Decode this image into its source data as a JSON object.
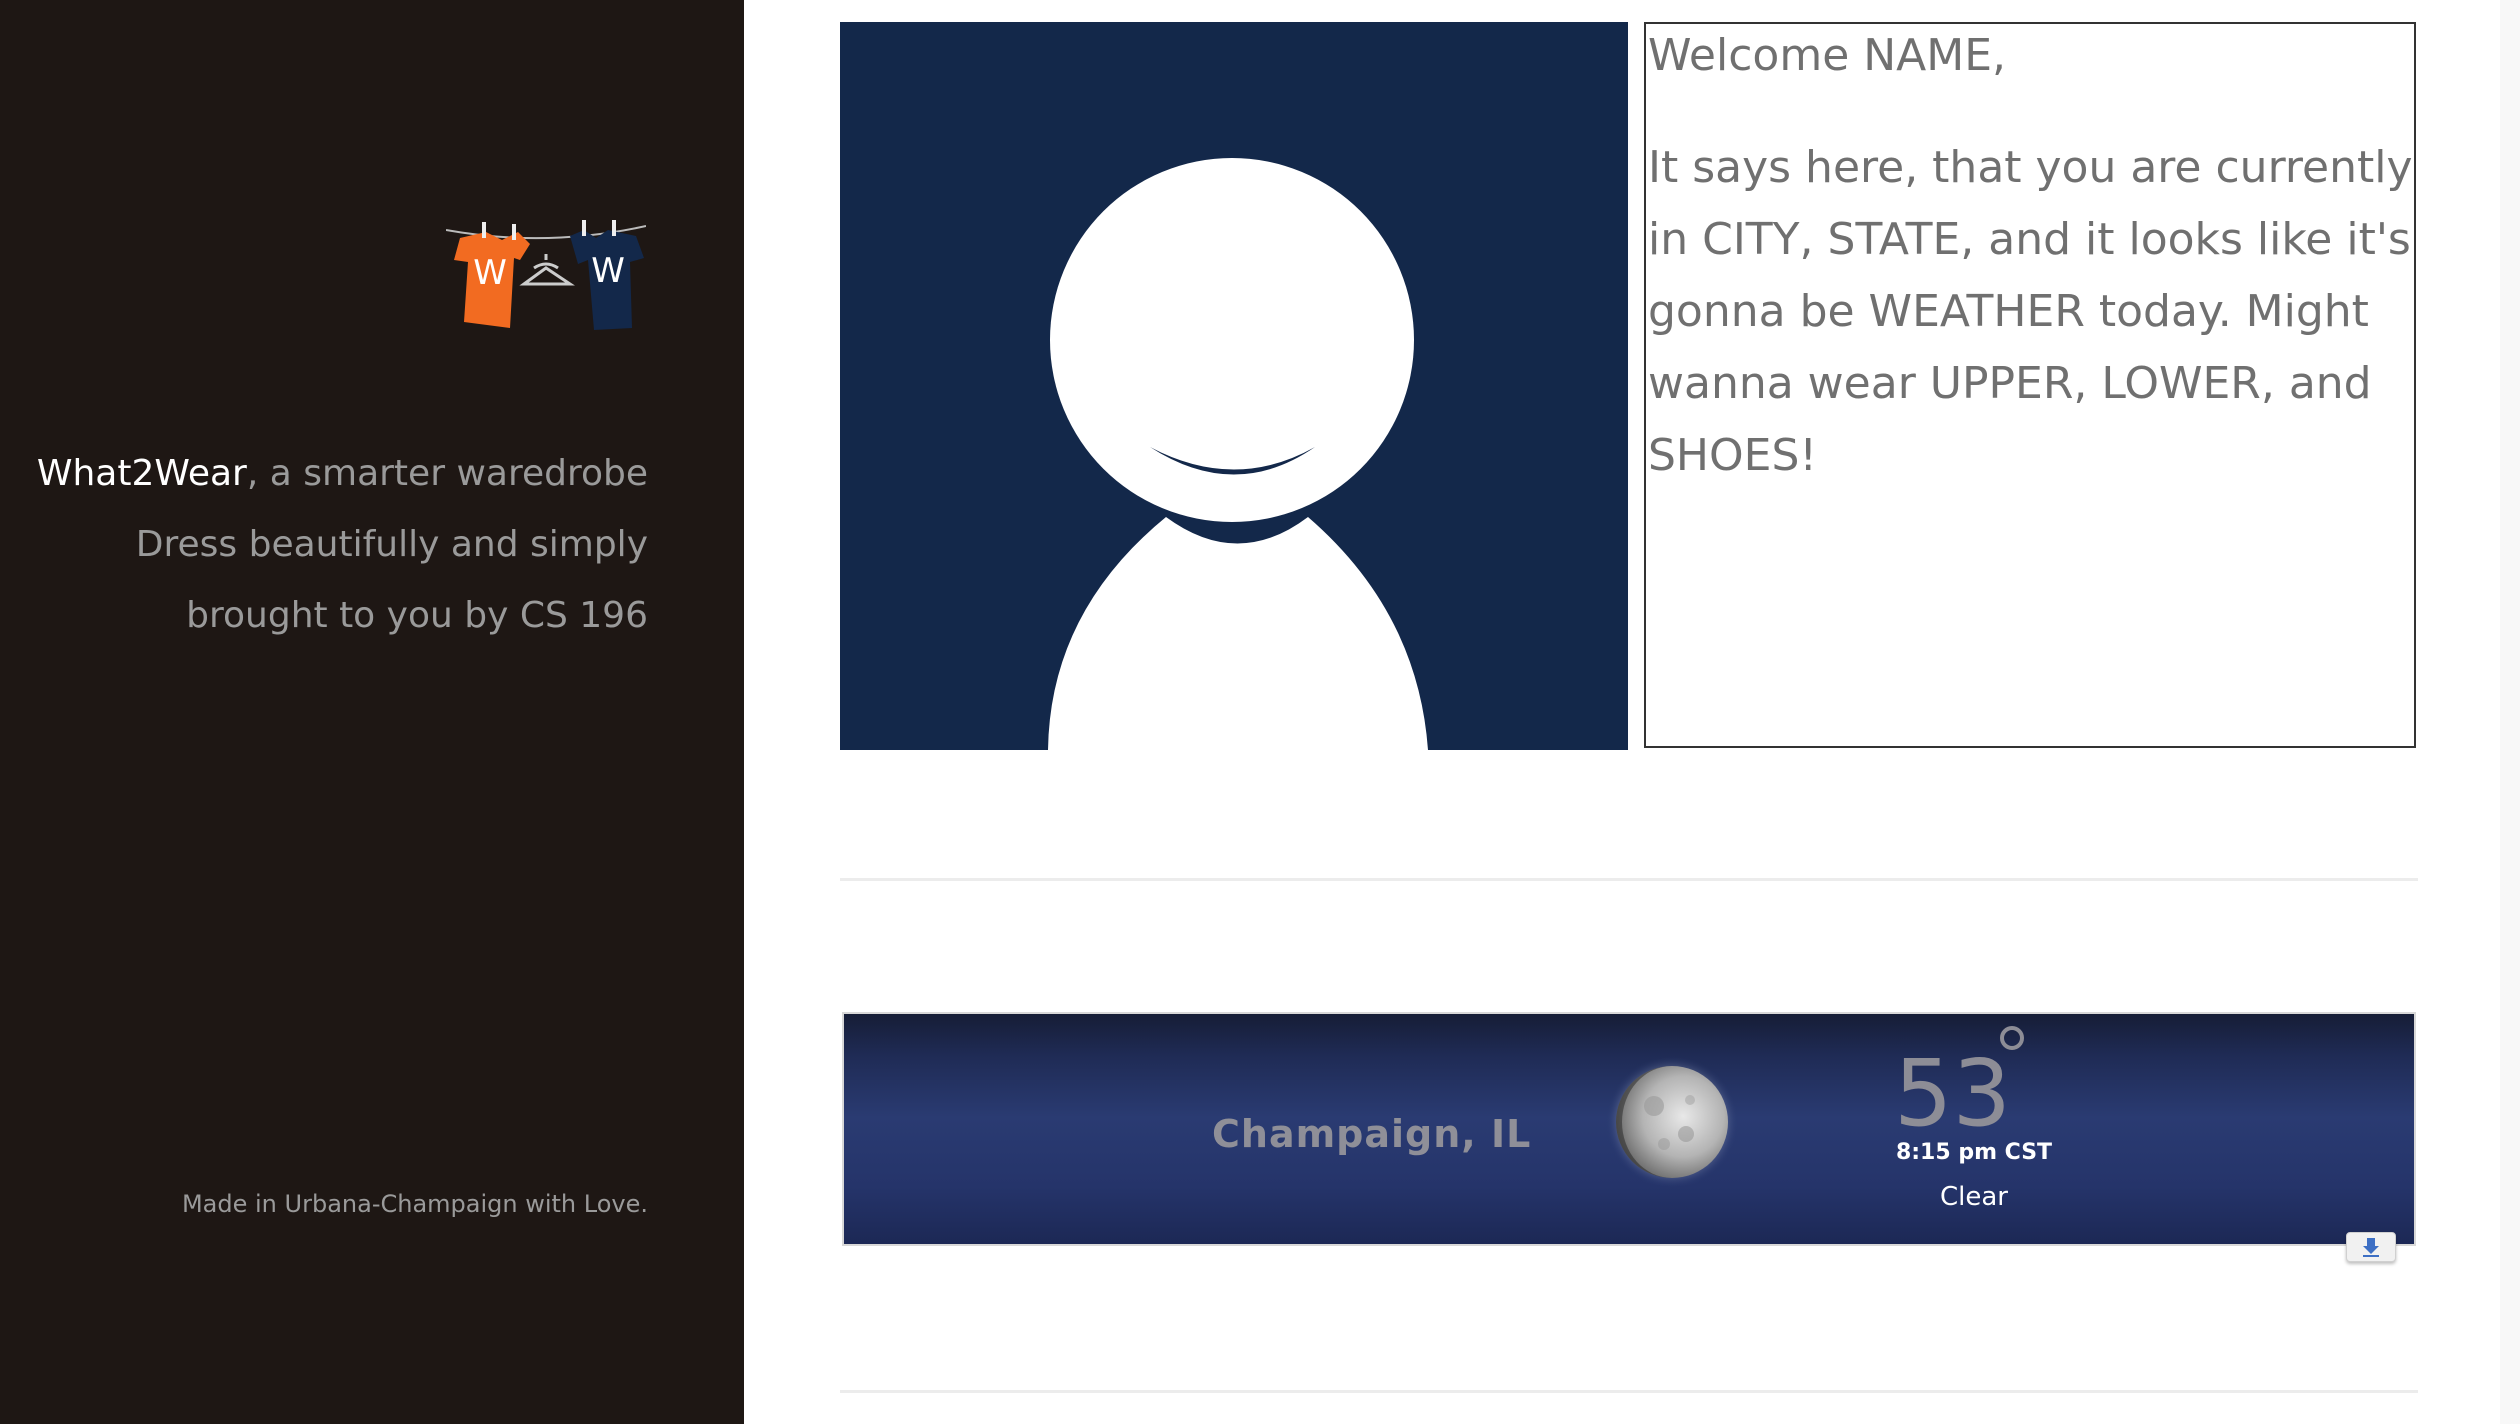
{
  "sidebar": {
    "brand": "What2Wear",
    "tagline_rest": ", a smarter waredrobe",
    "line2": "Dress beautifully and simply",
    "line3": "brought to you by CS 196",
    "footer": "Made in Urbana-Champaign with Love.",
    "logo_letters": [
      "W",
      "W"
    ],
    "colors": {
      "background": "#1e1714",
      "logo_left": "#f26b21",
      "logo_right": "#13284a"
    }
  },
  "profile": {
    "avatar_background": "#13284a"
  },
  "message": {
    "welcome": "Welcome NAME,",
    "body": "It says here, that you are currently in CITY, STATE, and it looks like it's gonna be WEATHER today. Might wanna wear UPPER, LOWER, and SHOES!"
  },
  "weather": {
    "city": "Champaign, IL",
    "temperature": "53",
    "time": "8:15 pm CST",
    "condition": "Clear",
    "icon": "moon-icon",
    "download_icon": "download-arrow-icon"
  }
}
